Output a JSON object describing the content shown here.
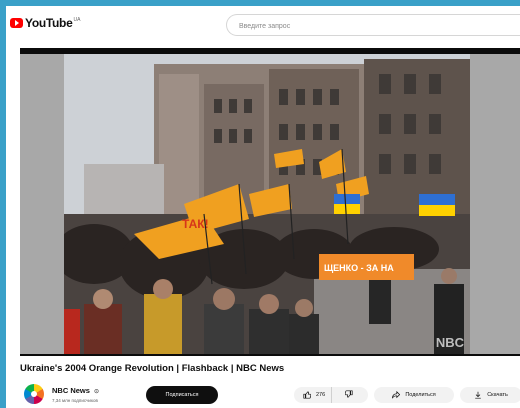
{
  "header": {
    "logo_text": "YouTube",
    "logo_superscript": "UA",
    "search_placeholder": "Введите запрос"
  },
  "video": {
    "title": "Ukraine's 2004 Orange Revolution | Flashback | NBC News",
    "banner_text": "ЩЕНКО - ЗА НА",
    "flag_text": "ТАК!",
    "watermark": "NBC"
  },
  "channel": {
    "name": "NBC News",
    "verified_mark": "⊙",
    "subscribers": "7,34 млн подписчиков",
    "subscribe_label": "Подписаться"
  },
  "actions": {
    "like_count": "276",
    "share_label": "Поделиться",
    "download_label": "Скачать"
  },
  "colors": {
    "accent_red": "#ff0000",
    "flag_orange": "#f0a020",
    "subscribe_bg": "#0f0f0f",
    "pill_bg": "#f2f2f2",
    "desktop_blue": "#3aa0c8"
  }
}
